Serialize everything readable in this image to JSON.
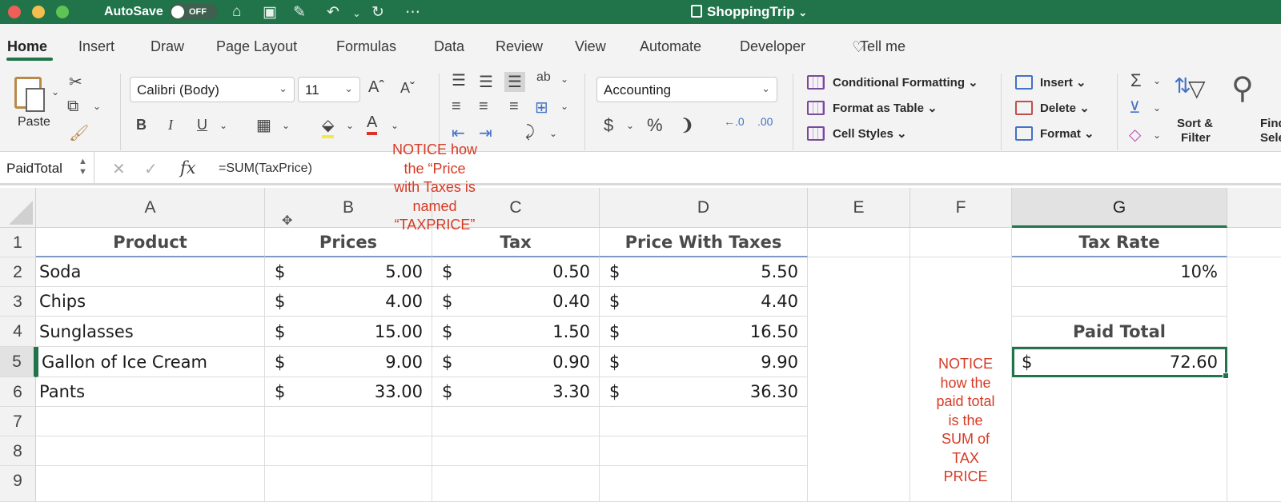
{
  "titlebar": {
    "autosave_label": "AutoSave",
    "autosave_state": "OFF",
    "doc_title": "ShoppingTrip",
    "icons": [
      "home-icon",
      "save-icon",
      "edit-icon",
      "undo-icon",
      "redo-icon",
      "more-icon"
    ]
  },
  "tabs": [
    "Home",
    "Insert",
    "Draw",
    "Page Layout",
    "Formulas",
    "Data",
    "Review",
    "View",
    "Automate",
    "Developer"
  ],
  "tell_me": "Tell me",
  "ribbon": {
    "paste": "Paste",
    "font_name": "Calibri (Body)",
    "font_size": "11",
    "bold": "B",
    "italic": "I",
    "underline": "U",
    "number_format": "Accounting",
    "currency": "$",
    "percent": "%",
    "comma": "❩",
    "conditional_formatting": "Conditional Formatting",
    "format_as_table": "Format as Table",
    "cell_styles": "Cell Styles",
    "insert": "Insert",
    "delete": "Delete",
    "format": "Format",
    "sort_filter_1": "Sort &",
    "sort_filter_2": "Filter",
    "find_1": "Find",
    "find_2": "Sele"
  },
  "formula_bar": {
    "name_box": "PaidTotal",
    "formula": "=SUM(TaxPrice)"
  },
  "columns": [
    "A",
    "B",
    "C",
    "D",
    "E",
    "F",
    "G"
  ],
  "rows": [
    "1",
    "2",
    "3",
    "4",
    "5",
    "6",
    "7",
    "8",
    "9"
  ],
  "table": {
    "headers": [
      "Product",
      "Prices",
      "Tax",
      "Price With Taxes"
    ],
    "currency_symbol": "$",
    "rows": [
      {
        "product": "Soda",
        "price": "5.00",
        "tax": "0.50",
        "total": "5.50"
      },
      {
        "product": "Chips",
        "price": "4.00",
        "tax": "0.40",
        "total": "4.40"
      },
      {
        "product": "Sunglasses",
        "price": "15.00",
        "tax": "1.50",
        "total": "16.50"
      },
      {
        "product": "Gallon of Ice Cream",
        "price": "9.00",
        "tax": "0.90",
        "total": "9.90"
      },
      {
        "product": "Pants",
        "price": "33.00",
        "tax": "3.30",
        "total": "36.30"
      }
    ]
  },
  "side": {
    "tax_rate_label": "Tax Rate",
    "tax_rate_value": "10%",
    "paid_total_label": "Paid Total",
    "paid_total_currency": "$",
    "paid_total_value": "72.60"
  },
  "notes": {
    "note1": [
      "NOTICE how",
      "the “Price",
      "with Taxes is",
      "named",
      "“TAXPRICE”"
    ],
    "note2": [
      "NOTICE",
      "how the",
      "paid total",
      "is the",
      "SUM of",
      "TAX",
      "PRICE"
    ]
  },
  "colors": {
    "excel_green": "#21744a",
    "note_red": "#d63a24"
  }
}
